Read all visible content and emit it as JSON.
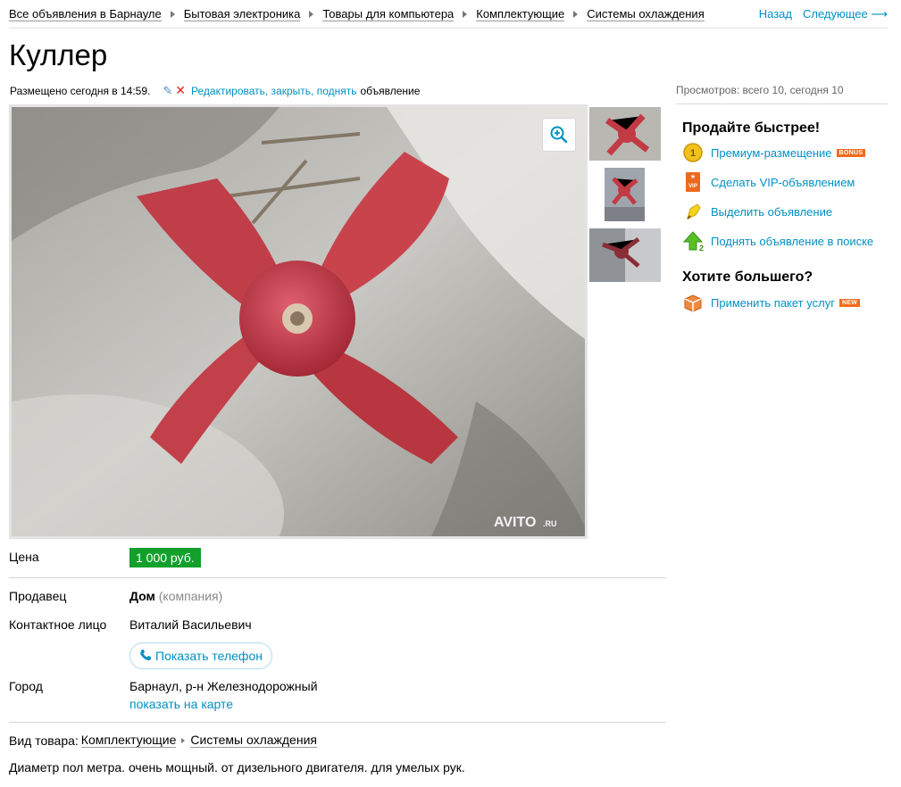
{
  "breadcrumbs": [
    "Все объявления в Барнауле",
    "Бытовая электроника",
    "Товары для компьютера",
    "Комплектующие",
    "Системы охлаждения"
  ],
  "nav": {
    "back": "Назад",
    "next": "Следующее ⟶"
  },
  "title": "Куллер",
  "posted": {
    "text": "Размещено сегодня в 14:59.",
    "edit_link": "Редактировать, закрыть, поднять",
    "edit_suffix": "объявление"
  },
  "views": "Просмотров: всего 10, сегодня 10",
  "photo": {
    "watermark": "AVITO",
    "watermark_suffix": ".RU"
  },
  "sidebar": {
    "sell_faster_title": "Продайте быстрее!",
    "services": [
      {
        "label": "Премиум-размещение",
        "badge": "BONUS",
        "icon": "coin-icon"
      },
      {
        "label": "Сделать VIP-объявлением",
        "icon": "vip-icon",
        "icon_text": "VIP"
      },
      {
        "label": "Выделить объявление",
        "icon": "highlighter-icon"
      },
      {
        "label": "Поднять объявление в поиске",
        "icon": "up-arrow-icon"
      }
    ],
    "want_more_title": "Хотите большего?",
    "package": {
      "label": "Применить пакет услуг",
      "badge": "NEW",
      "icon": "package-icon"
    }
  },
  "details": {
    "price_label": "Цена",
    "price": "1 000 руб.",
    "seller_label": "Продавец",
    "seller_name": "Дом",
    "seller_type": "(компания)",
    "contact_label": "Контактное лицо",
    "contact_name": "Виталий Васильевич",
    "phone_button": "Показать телефон",
    "city_label": "Город",
    "city": "Барнаул, р-н Железнодорожный",
    "map_link": "показать на карте",
    "category_label": "Вид товара:",
    "category": [
      "Комплектующие",
      "Системы охлаждения"
    ],
    "description": "Диаметр пол метра. очень мощный. от дизельного двигателя. для умелых рук."
  },
  "colors": {
    "link": "#0091c3",
    "price_bg": "#12a02b",
    "badge": "#f26b1d",
    "fan_red": "#c23a44"
  }
}
